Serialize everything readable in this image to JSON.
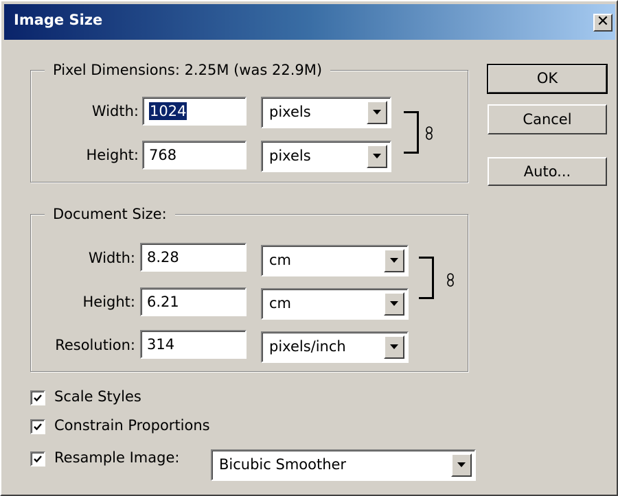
{
  "window": {
    "title": "Image Size",
    "close_glyph": "✕"
  },
  "pixel_dimensions": {
    "legend": "Pixel Dimensions:  2.25M (was 22.9M)",
    "width_label": "Width:",
    "width_value": "1024",
    "width_unit": "pixels",
    "height_label": "Height:",
    "height_value": "768",
    "height_unit": "pixels"
  },
  "document_size": {
    "legend": "Document Size:",
    "width_label": "Width:",
    "width_value": "8.28",
    "width_unit": "cm",
    "height_label": "Height:",
    "height_value": "6.21",
    "height_unit": "cm",
    "resolution_label": "Resolution:",
    "resolution_value": "314",
    "resolution_unit": "pixels/inch"
  },
  "options": {
    "scale_styles": {
      "label": "Scale Styles",
      "checked": true
    },
    "constrain_proportions": {
      "label": "Constrain Proportions",
      "checked": true
    },
    "resample_image": {
      "label": "Resample Image:",
      "checked": true,
      "method": "Bicubic Smoother"
    }
  },
  "buttons": {
    "ok": "OK",
    "cancel": "Cancel",
    "auto": "Auto..."
  },
  "colors": {
    "title_start": "#0a246a",
    "title_end": "#a6caf0",
    "face": "#d4d0c8",
    "selection": "#0a246a"
  },
  "icons": {
    "link": "chain-link-icon",
    "check": "checkmark-icon",
    "dropdown": "chevron-down-icon"
  }
}
